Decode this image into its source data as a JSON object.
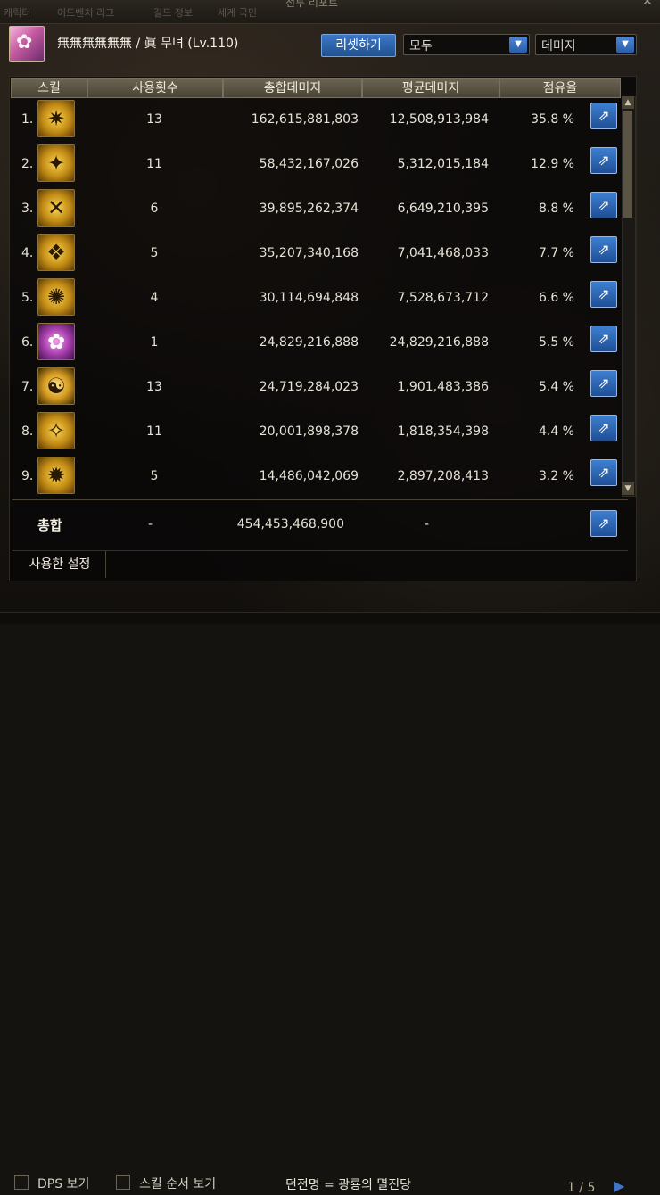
{
  "window": {
    "title": "전투 리포트",
    "close_icon": "close-icon",
    "background_tabs": [
      "캐릭터",
      "어드벤처 리그",
      "길드 정보",
      "세계 국민"
    ]
  },
  "header": {
    "avatar_icon": "character-portrait-icon",
    "character_name": "無無無無無無 / 眞 무녀 (Lv.110)",
    "reset_label": "리셋하기",
    "filter_select": {
      "value": "모두"
    },
    "sort_select": {
      "value": "데미지"
    }
  },
  "columns": {
    "skill": "스킬",
    "uses": "사용횟수",
    "total": "총합데미지",
    "avg": "평균데미지",
    "share": "점유율"
  },
  "rows": [
    {
      "rank": "1.",
      "icon": "skill-icon",
      "uses": "13",
      "total": "162,615,881,803",
      "avg": "12,508,913,984",
      "share": "35.8 %"
    },
    {
      "rank": "2.",
      "icon": "skill-icon",
      "uses": "11",
      "total": "58,432,167,026",
      "avg": "5,312,015,184",
      "share": "12.9 %"
    },
    {
      "rank": "3.",
      "icon": "skill-icon",
      "uses": "6",
      "total": "39,895,262,374",
      "avg": "6,649,210,395",
      "share": "8.8 %"
    },
    {
      "rank": "4.",
      "icon": "skill-icon",
      "uses": "5",
      "total": "35,207,340,168",
      "avg": "7,041,468,033",
      "share": "7.7 %"
    },
    {
      "rank": "5.",
      "icon": "skill-icon",
      "uses": "4",
      "total": "30,114,694,848",
      "avg": "7,528,673,712",
      "share": "6.6 %"
    },
    {
      "rank": "6.",
      "icon": "skill-icon",
      "uses": "1",
      "total": "24,829,216,888",
      "avg": "24,829,216,888",
      "share": "5.5 %"
    },
    {
      "rank": "7.",
      "icon": "skill-icon",
      "uses": "13",
      "total": "24,719,284,023",
      "avg": "1,901,483,386",
      "share": "5.4 %"
    },
    {
      "rank": "8.",
      "icon": "skill-icon",
      "uses": "11",
      "total": "20,001,898,378",
      "avg": "1,818,354,398",
      "share": "4.4 %"
    },
    {
      "rank": "9.",
      "icon": "skill-icon",
      "uses": "5",
      "total": "14,486,042,069",
      "avg": "2,897,208,413",
      "share": "3.2 %"
    }
  ],
  "summary": {
    "label": "총합",
    "uses": "-",
    "total": "454,453,468,900",
    "avg": "-"
  },
  "settings_tab": "사용한 설정",
  "footer": {
    "dps_label": "DPS 보기",
    "skill_order_label": "스킬 순서 보기",
    "dungeon_label": "던전명 = 광룡의 멸진당",
    "pager": "1 / 5"
  },
  "colors": {
    "accent_blue": "#2f66b8",
    "panel_bg": "#0b0a08",
    "header_bar": "#5a5344"
  }
}
